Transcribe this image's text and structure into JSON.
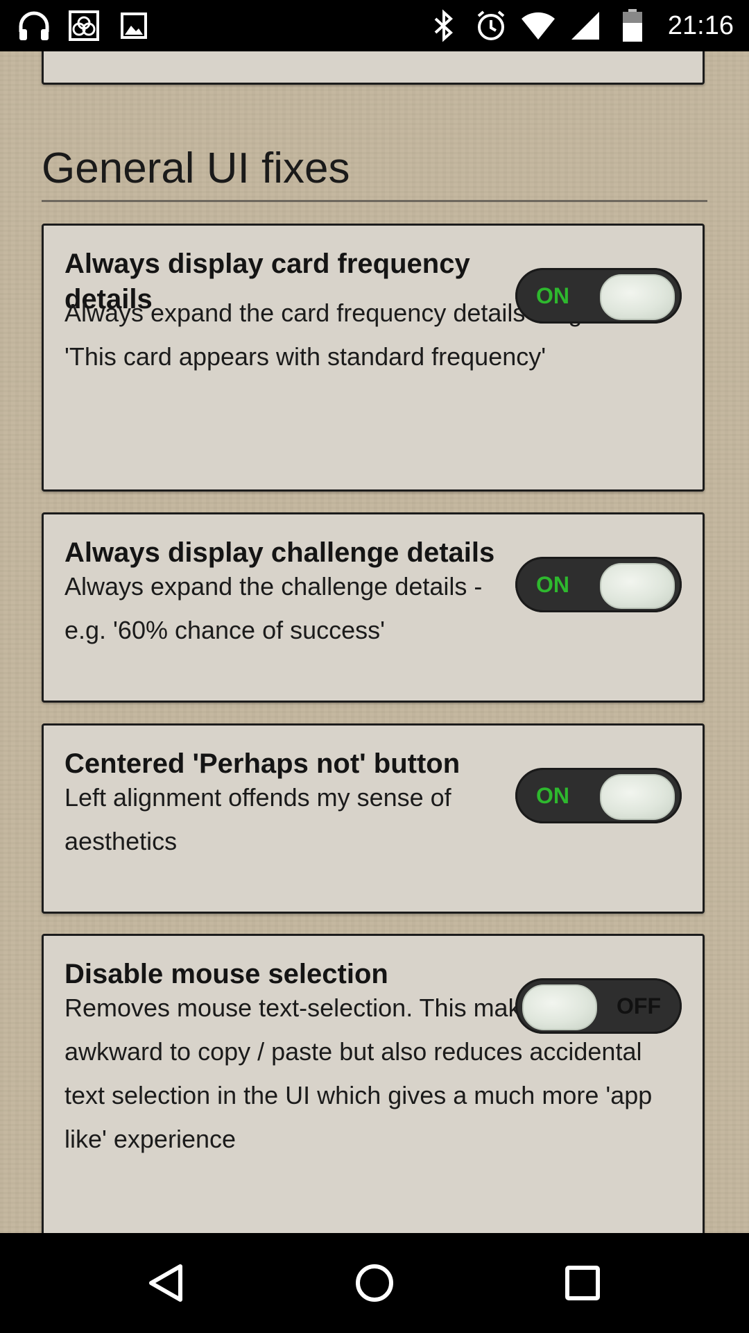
{
  "status_bar": {
    "time": "21:16",
    "icons_left": [
      "headphones-icon",
      "app-icon",
      "image-icon"
    ],
    "icons_right": [
      "bluetooth-icon",
      "alarm-icon",
      "wifi-icon",
      "signal-icon",
      "battery-icon"
    ]
  },
  "section": {
    "title": "General UI fixes"
  },
  "settings": [
    {
      "title": "Always display card frequency details",
      "description": "Always expand the card frequency details - e.g. 'This card appears with standard frequency'",
      "state": "ON"
    },
    {
      "title": "Always display challenge details",
      "description": "Always expand the challenge details - e.g. '60% chance of success'",
      "state": "ON"
    },
    {
      "title": "Centered 'Perhaps not' button",
      "description": "Left alignment offends my sense of aesthetics",
      "state": "ON"
    },
    {
      "title": "Disable mouse selection",
      "description": "Removes mouse text-selection. This makes it more awkward to copy / paste but also reduces accidental text selection in the UI which gives a much more 'app like' experience",
      "state": "OFF"
    }
  ],
  "nav_bar": {
    "buttons": [
      "back-icon",
      "home-icon",
      "recents-icon"
    ]
  },
  "colors": {
    "background": "#c3b69d",
    "card": "#d8d3ca",
    "toggle_track": "#2e2e2e",
    "toggle_on_text": "#2eb82e"
  }
}
